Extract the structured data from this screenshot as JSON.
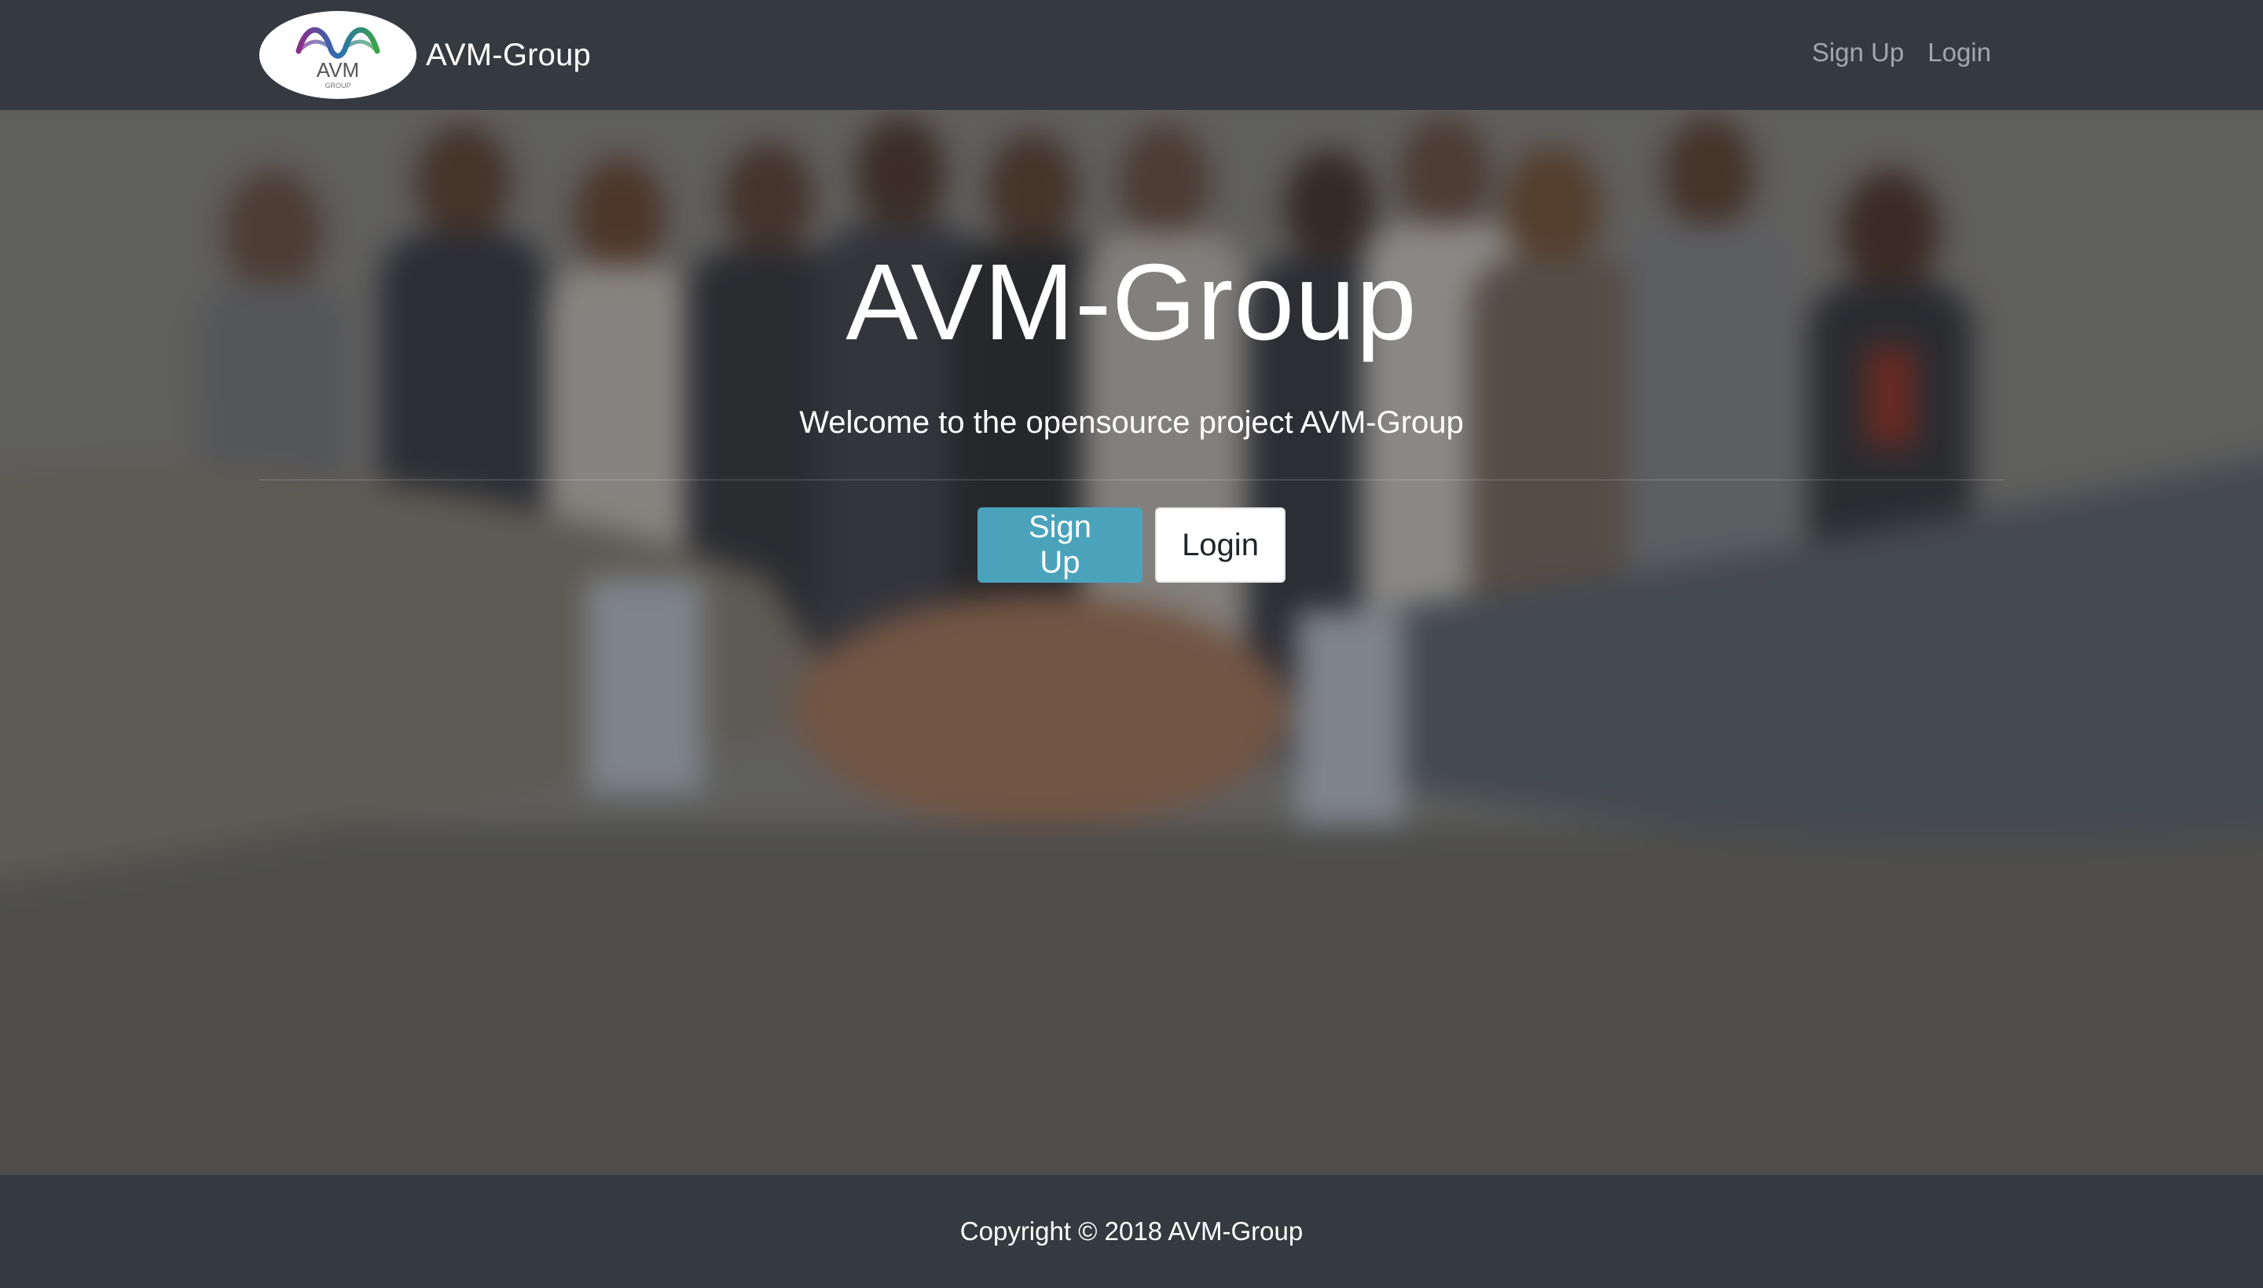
{
  "navbar": {
    "brand_name": "AVM-Group",
    "logo": {
      "icon": "avm-logo-icon",
      "text": "AVM",
      "subtext": "GROUP"
    },
    "links": [
      {
        "label": "Sign Up"
      },
      {
        "label": "Login"
      }
    ]
  },
  "hero": {
    "title": "AVM-Group",
    "subtitle": "Welcome to the opensource project AVM-Group",
    "buttons": {
      "signup_label": "Sign Up",
      "login_label": "Login"
    },
    "background_image": "blurred-business-people-handshake-photo"
  },
  "footer": {
    "copyright": "Copyright © 2018 AVM-Group"
  },
  "colors": {
    "navbar_bg": "#343a40",
    "primary_button": "#4aa3bb",
    "secondary_button": "#ffffff",
    "text_light": "#ffffff",
    "nav_link": "rgba(255,255,255,0.55)"
  }
}
